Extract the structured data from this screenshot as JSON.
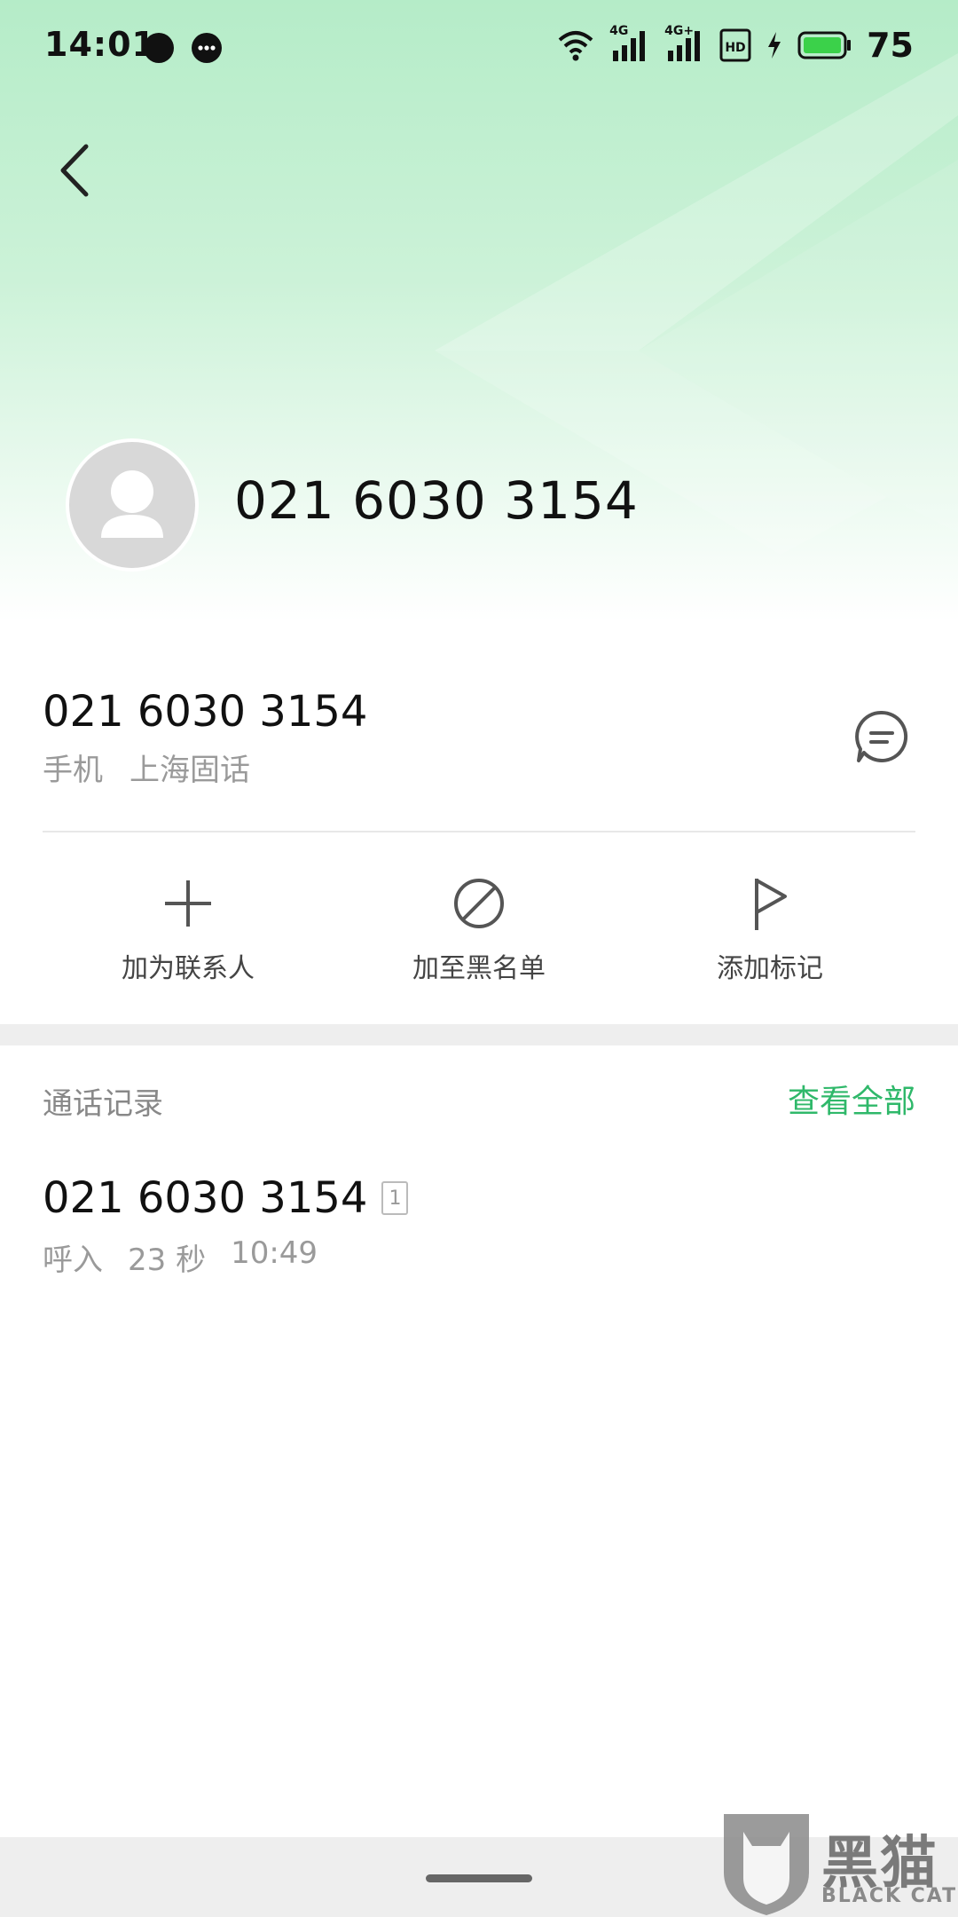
{
  "status_bar": {
    "time": "14:01",
    "battery_percent": "75",
    "signal_labels": [
      "4G",
      "4G+"
    ],
    "icons": [
      "chat-bubble-icon",
      "message-dots-icon",
      "wifi-icon",
      "signal-icon",
      "signal-icon",
      "hd-icon",
      "charging-icon",
      "battery-icon"
    ]
  },
  "header": {
    "back_icon": "chevron-left-icon",
    "avatar_icon": "person-icon",
    "number": "021 6030 3154"
  },
  "detail": {
    "number": "021 6030 3154",
    "type": "手机",
    "location": "上海固话",
    "message_icon": "message-icon"
  },
  "actions": [
    {
      "label": "加为联系人",
      "icon": "plus-icon"
    },
    {
      "label": "加至黑名单",
      "icon": "block-icon"
    },
    {
      "label": "添加标记",
      "icon": "flag-icon"
    }
  ],
  "call_log": {
    "title": "通话记录",
    "view_all": "查看全部",
    "entries": [
      {
        "number": "021 6030 3154",
        "sim": "1",
        "direction": "呼入",
        "duration": "23 秒",
        "time": "10:49"
      }
    ]
  },
  "watermark": {
    "text_cn": "黑猫",
    "text_en": "BLACK CAT"
  },
  "colors": {
    "accent": "#2fb86a",
    "hero_top": "#b5ecc8",
    "battery": "#3bd14a"
  }
}
